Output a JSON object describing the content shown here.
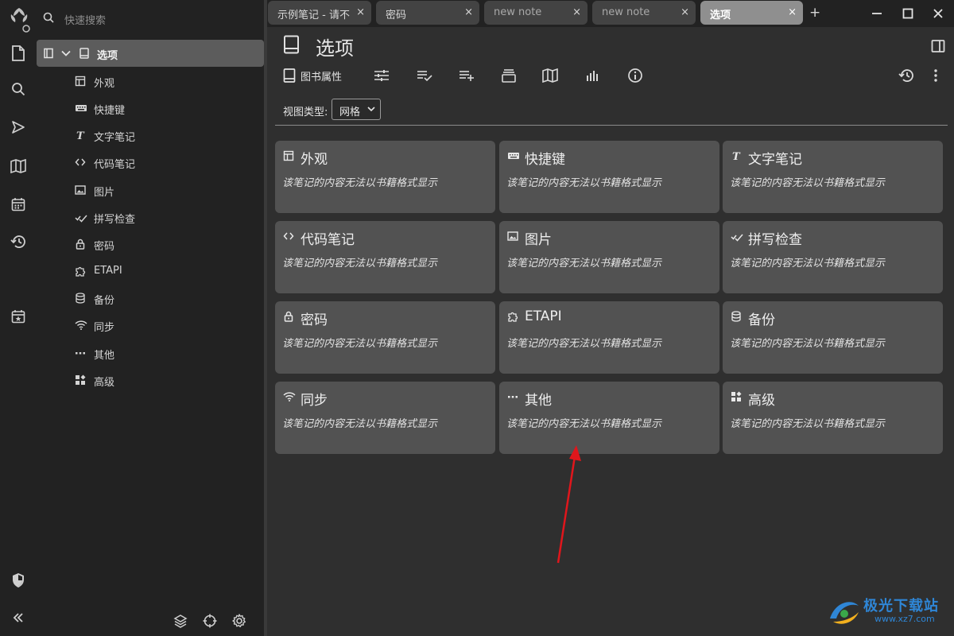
{
  "search": {
    "placeholder": "快速搜索"
  },
  "tree": {
    "root": "选项",
    "items": [
      {
        "label": "外观",
        "icon": "layout-icon"
      },
      {
        "label": "快捷键",
        "icon": "keyboard-icon"
      },
      {
        "label": "文字笔记",
        "icon": "text-icon"
      },
      {
        "label": "代码笔记",
        "icon": "code-icon"
      },
      {
        "label": "图片",
        "icon": "image-icon"
      },
      {
        "label": "拼写检查",
        "icon": "spellcheck-icon"
      },
      {
        "label": "密码",
        "icon": "lock-icon"
      },
      {
        "label": "ETAPI",
        "icon": "extension-icon"
      },
      {
        "label": "备份",
        "icon": "database-icon"
      },
      {
        "label": "同步",
        "icon": "wifi-icon"
      },
      {
        "label": "其他",
        "icon": "more-icon"
      },
      {
        "label": "高级",
        "icon": "widgets-icon"
      }
    ]
  },
  "tabs": [
    {
      "label": "示例笔记 - 请不",
      "close": "×"
    },
    {
      "label": "密码",
      "close": "×"
    },
    {
      "label": "new note",
      "close": "×"
    },
    {
      "label": "new note",
      "close": "×"
    },
    {
      "label": "选项",
      "close": "×"
    }
  ],
  "tab_add": "+",
  "note": {
    "title": "选项"
  },
  "ribbon": {
    "book_properties": "图书属性"
  },
  "props": {
    "view_type_label": "视图类型:",
    "view_type_value": "网格"
  },
  "cards": [
    {
      "title": "外观",
      "desc": "该笔记的内容无法以书籍格式显示",
      "icon": "layout-icon"
    },
    {
      "title": "快捷键",
      "desc": "该笔记的内容无法以书籍格式显示",
      "icon": "keyboard-icon"
    },
    {
      "title": "文字笔记",
      "desc": "该笔记的内容无法以书籍格式显示",
      "icon": "text-icon"
    },
    {
      "title": "代码笔记",
      "desc": "该笔记的内容无法以书籍格式显示",
      "icon": "code-icon"
    },
    {
      "title": "图片",
      "desc": "该笔记的内容无法以书籍格式显示",
      "icon": "image-icon"
    },
    {
      "title": "拼写检查",
      "desc": "该笔记的内容无法以书籍格式显示",
      "icon": "spellcheck-icon"
    },
    {
      "title": "密码",
      "desc": "该笔记的内容无法以书籍格式显示",
      "icon": "lock-icon"
    },
    {
      "title": "ETAPI",
      "desc": "该笔记的内容无法以书籍格式显示",
      "icon": "extension-icon"
    },
    {
      "title": "备份",
      "desc": "该笔记的内容无法以书籍格式显示",
      "icon": "database-icon"
    },
    {
      "title": "同步",
      "desc": "该笔记的内容无法以书籍格式显示",
      "icon": "wifi-icon"
    },
    {
      "title": "其他",
      "desc": "该笔记的内容无法以书籍格式显示",
      "icon": "more-icon"
    },
    {
      "title": "高级",
      "desc": "该笔记的内容无法以书籍格式显示",
      "icon": "widgets-icon"
    }
  ],
  "watermark": {
    "main": "极光下载站",
    "url": "www.xz7.com"
  },
  "colors": {
    "background": "#2f2f2f",
    "sidebar": "#222222",
    "card": "#525252",
    "active_tab": "#8f8f8f",
    "arrow": "#e0161c",
    "watermark": "#2f86d6"
  }
}
